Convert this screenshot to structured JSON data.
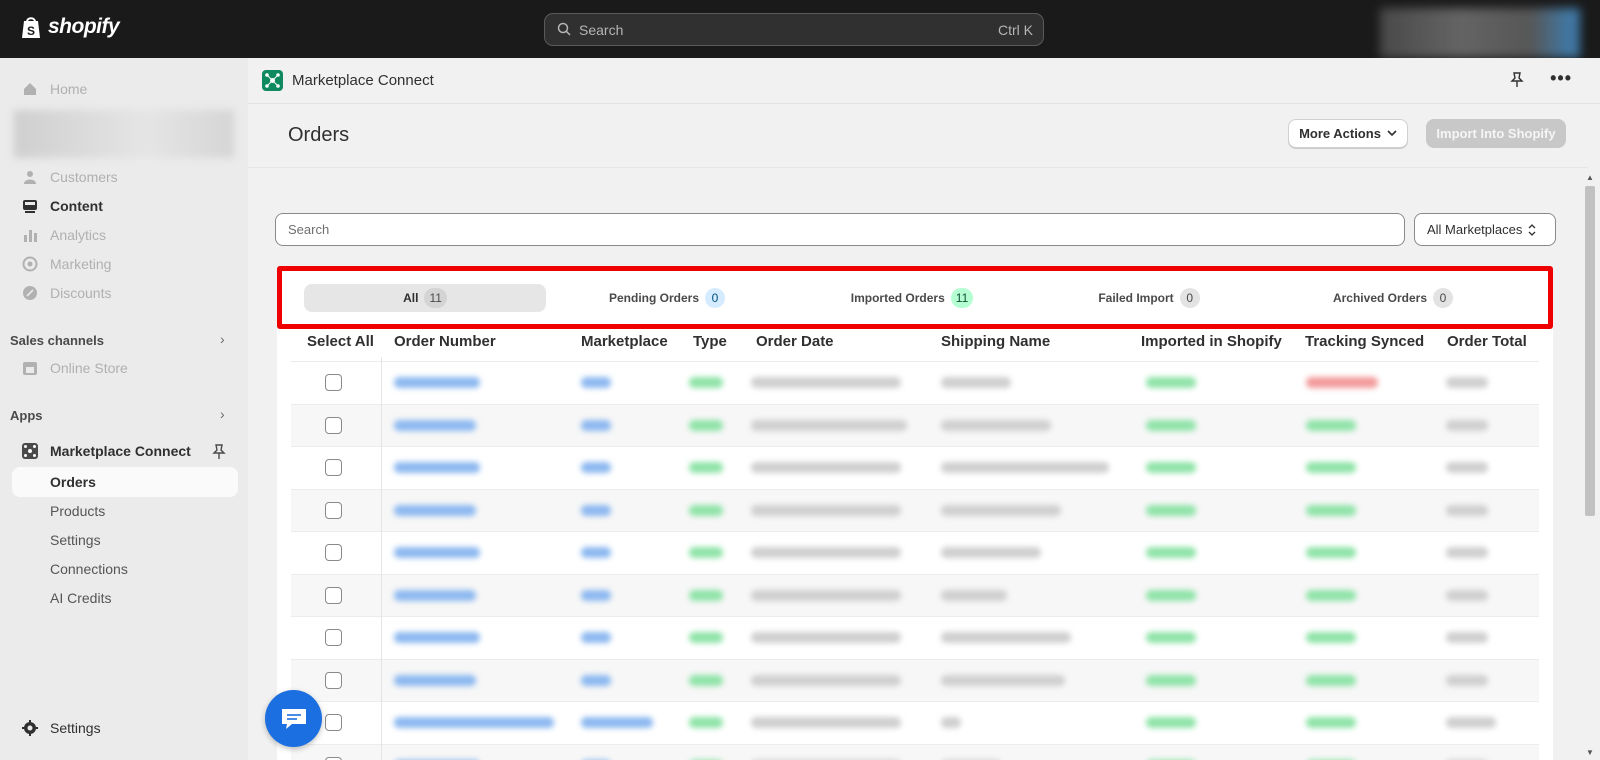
{
  "topbar": {
    "brand": "shopify",
    "search_placeholder": "Search",
    "search_shortcut": "Ctrl K"
  },
  "sidebar": {
    "nav": [
      {
        "label": "Home",
        "icon": "home-icon"
      },
      {
        "label": "Customers",
        "icon": "person-icon"
      },
      {
        "label": "Content",
        "icon": "content-icon"
      },
      {
        "label": "Analytics",
        "icon": "bar-chart-icon"
      },
      {
        "label": "Marketing",
        "icon": "target-icon"
      },
      {
        "label": "Discounts",
        "icon": "discount-icon"
      }
    ],
    "sales_channels_label": "Sales channels",
    "online_store": "Online Store",
    "apps_label": "Apps",
    "app_name": "Marketplace Connect",
    "app_sub": [
      "Orders",
      "Products",
      "Settings",
      "Connections",
      "AI Credits"
    ],
    "settings": "Settings"
  },
  "header": {
    "app_title": "Marketplace Connect"
  },
  "page": {
    "title": "Orders",
    "more_actions": "More Actions",
    "import_button": "Import Into Shopify",
    "search_placeholder": "Search",
    "marketplace_select": "All Marketplaces"
  },
  "tabs": [
    {
      "label": "All",
      "count": "11"
    },
    {
      "label": "Pending Orders",
      "count": "0"
    },
    {
      "label": "Imported Orders",
      "count": "11"
    },
    {
      "label": "Failed Import",
      "count": "0"
    },
    {
      "label": "Archived Orders",
      "count": "0"
    }
  ],
  "table": {
    "columns": [
      "Select All",
      "Order Number",
      "Marketplace",
      "Type",
      "Order Date",
      "Shipping Name",
      "Imported in Shopify",
      "Tracking Synced",
      "Order Total"
    ]
  },
  "colors": {
    "accent_red": "#ee0000",
    "app_green": "#0f8a5f",
    "chat_blue": "#1c6fe0"
  }
}
